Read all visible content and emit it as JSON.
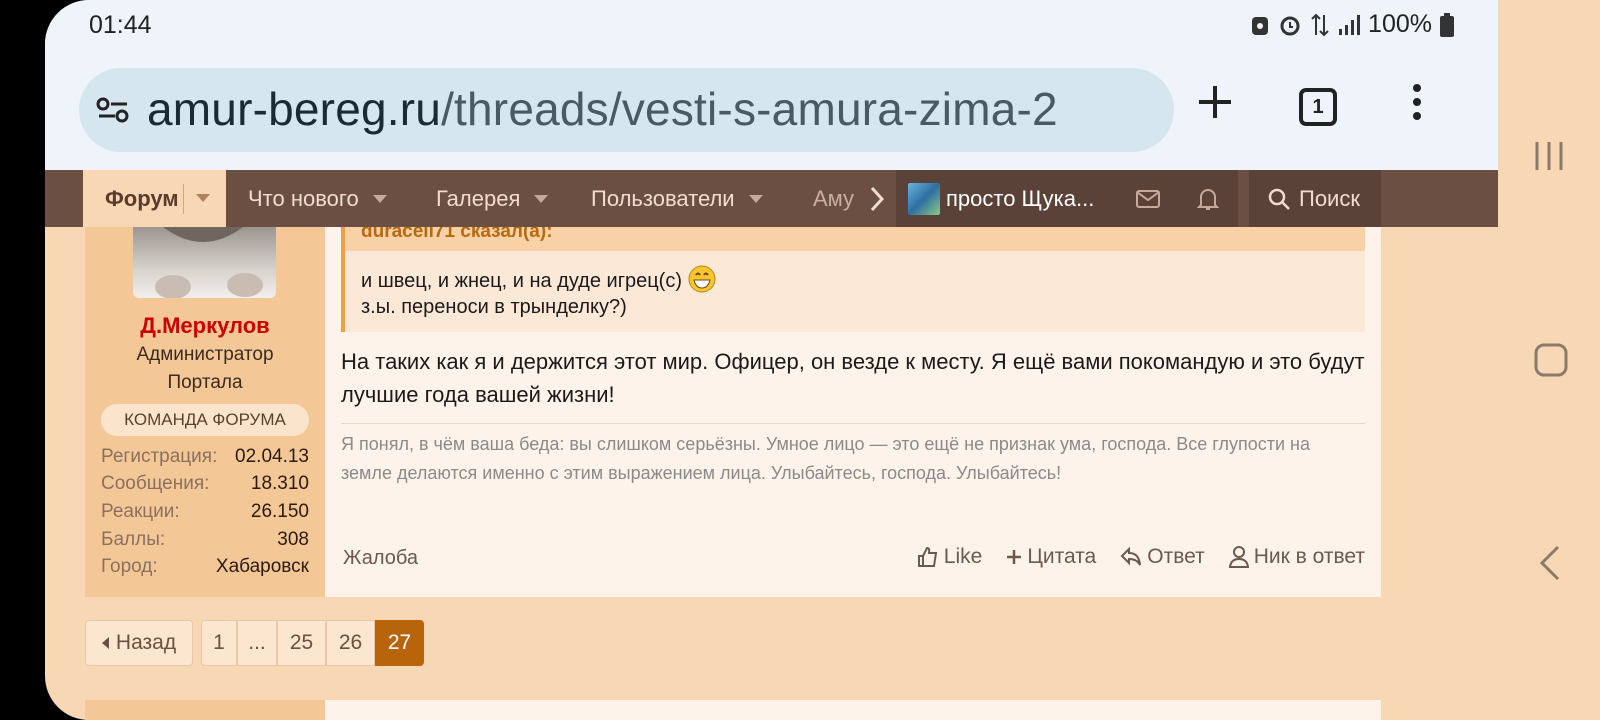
{
  "status": {
    "time": "01:44",
    "battery": "100%"
  },
  "browser": {
    "url_domain": "amur-bereg.ru",
    "url_path": "/threads/vesti-s-amura-zima-2",
    "tab_count": "1"
  },
  "nav": {
    "items": [
      "Форум",
      "Что нового",
      "Галерея",
      "Пользователи",
      "Аму"
    ],
    "user": "просто Щука...",
    "search": "Поиск"
  },
  "post": {
    "author": "Д.Меркулов",
    "title_line1": "Администратор",
    "title_line2": "Портала",
    "badge": "КОМАНДА ФОРУМА",
    "stats": [
      {
        "k": "Регистрация:",
        "v": "02.04.13"
      },
      {
        "k": "Сообщения:",
        "v": "18.310"
      },
      {
        "k": "Реакции:",
        "v": "26.150"
      },
      {
        "k": "Баллы:",
        "v": "308"
      },
      {
        "k": "Город:",
        "v": "Хабаровск"
      }
    ],
    "quote_header": "duracell71 сказал(а):",
    "quote_line1": "и швец, и жнец, и на дуде игрец(с)",
    "quote_line2": "з.ы. переноси в трынделку?)",
    "message": "На таких как я и держится этот мир. Офицер, он везде к месту. Я ещё вами покомандую и это будут лучшие года вашей жизни!",
    "signature": "Я понял, в чём ваша беда: вы слишком серьёзны. Умное лицо — это ещё не признак ума, господа. Все глупости на земле делаются именно с этим выражением лица. Улыбайтесь, господа. Улыбайтесь!",
    "report": "Жалоба",
    "actions": {
      "like": "Like",
      "quote": "Цитата",
      "reply": "Ответ",
      "mention": "Ник в ответ"
    }
  },
  "pager": {
    "back": "Назад",
    "pages": [
      "1",
      "...",
      "25",
      "26"
    ],
    "current": "27"
  }
}
